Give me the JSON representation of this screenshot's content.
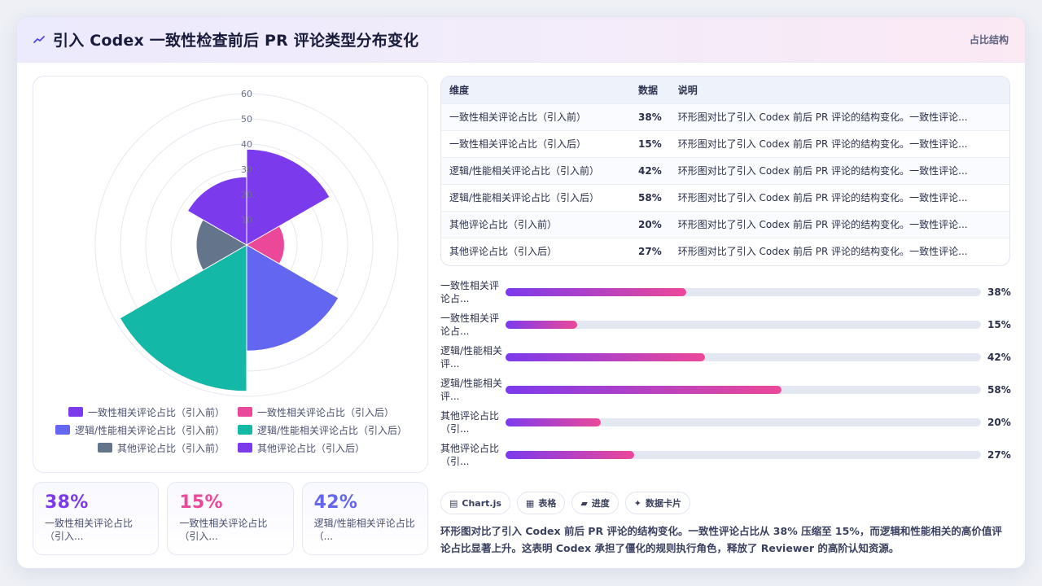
{
  "header": {
    "title": "引入 Codex 一致性检查前后 PR 评论类型分布变化",
    "tag": "占比结构"
  },
  "colors": {
    "purple": "#7c3aed",
    "pink": "#ec4899",
    "indigo": "#6366f1",
    "teal": "#14b8a6",
    "slate": "#64748b",
    "violet": "#7c3aed"
  },
  "chart_data": {
    "type": "polarArea",
    "labels": [
      "一致性相关评论占比（引入前）",
      "一致性相关评论占比（引入后）",
      "逻辑/性能相关评论占比（引入前）",
      "逻辑/性能相关评论占比（引入后）",
      "其他评论占比（引入前）",
      "其他评论占比（引入后）"
    ],
    "values": [
      38,
      15,
      42,
      58,
      20,
      27
    ],
    "colors": [
      "#7c3aed",
      "#ec4899",
      "#6366f1",
      "#14b8a6",
      "#64748b",
      "#7c3aed"
    ],
    "r_ticks": [
      "10",
      "20",
      "30",
      "40",
      "50",
      "60"
    ],
    "r_max": 60,
    "legend_position": "bottom",
    "grid": true
  },
  "kpis": [
    {
      "value": "38%",
      "label": "一致性相关评论占比（引入...",
      "color": "#7c3aed"
    },
    {
      "value": "15%",
      "label": "一致性相关评论占比（引入...",
      "color": "#ec4899"
    },
    {
      "value": "42%",
      "label": "逻辑/性能相关评论占比（...",
      "color": "#6366f1"
    }
  ],
  "table": {
    "headers": [
      "维度",
      "数据",
      "说明"
    ],
    "rows": [
      {
        "dim": "一致性相关评论占比（引入前）",
        "val": "38%",
        "desc": "环形图对比了引入 Codex 前后 PR 评论的结构变化。一致性评论..."
      },
      {
        "dim": "一致性相关评论占比（引入后）",
        "val": "15%",
        "desc": "环形图对比了引入 Codex 前后 PR 评论的结构变化。一致性评论..."
      },
      {
        "dim": "逻辑/性能相关评论占比（引入前）",
        "val": "42%",
        "desc": "环形图对比了引入 Codex 前后 PR 评论的结构变化。一致性评论..."
      },
      {
        "dim": "逻辑/性能相关评论占比（引入后）",
        "val": "58%",
        "desc": "环形图对比了引入 Codex 前后 PR 评论的结构变化。一致性评论..."
      },
      {
        "dim": "其他评论占比（引入前）",
        "val": "20%",
        "desc": "环形图对比了引入 Codex 前后 PR 评论的结构变化。一致性评论..."
      },
      {
        "dim": "其他评论占比（引入后）",
        "val": "27%",
        "desc": "环形图对比了引入 Codex 前后 PR 评论的结构变化。一致性评论..."
      }
    ]
  },
  "progress": [
    {
      "label": "一致性相关评论占...",
      "value": "38%",
      "fraction": 0.38
    },
    {
      "label": "一致性相关评论占...",
      "value": "15%",
      "fraction": 0.15
    },
    {
      "label": "逻辑/性能相关评...",
      "value": "42%",
      "fraction": 0.42
    },
    {
      "label": "逻辑/性能相关评...",
      "value": "58%",
      "fraction": 0.58
    },
    {
      "label": "其他评论占比（引...",
      "value": "20%",
      "fraction": 0.2
    },
    {
      "label": "其他评论占比（引...",
      "value": "27%",
      "fraction": 0.27
    }
  ],
  "tags": [
    {
      "icon": "chart-icon",
      "glyph": "▤",
      "label": "Chart.js"
    },
    {
      "icon": "table-icon",
      "glyph": "▦",
      "label": "表格"
    },
    {
      "icon": "progress-icon",
      "glyph": "▰",
      "label": "进度"
    },
    {
      "icon": "sparkle-icon",
      "glyph": "✦",
      "label": "数据卡片"
    }
  ],
  "summary": "环形图对比了引入 Codex 前后 PR 评论的结构变化。一致性评论占比从 38% 压缩至 15%，而逻辑和性能相关的高价值评论占比显著上升。这表明 Codex 承担了僵化的规则执行角色，释放了 Reviewer 的高阶认知资源。"
}
